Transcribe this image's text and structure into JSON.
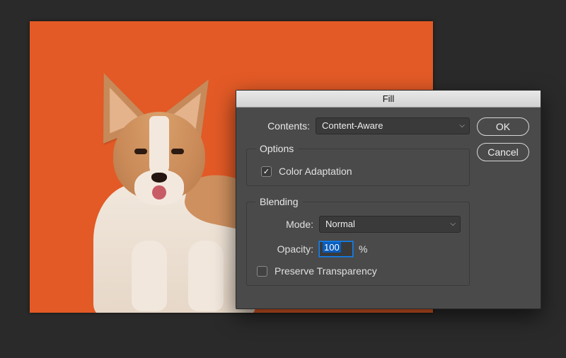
{
  "canvas": {
    "bg_color": "#e35a26",
    "subject": "corgi-puppy"
  },
  "dialog": {
    "title": "Fill",
    "contents_label": "Contents:",
    "contents_value": "Content-Aware",
    "options_legend": "Options",
    "color_adaptation_label": "Color Adaptation",
    "color_adaptation_checked": true,
    "blending_legend": "Blending",
    "mode_label": "Mode:",
    "mode_value": "Normal",
    "opacity_label": "Opacity:",
    "opacity_value": "100",
    "opacity_suffix": "%",
    "preserve_transparency_label": "Preserve Transparency",
    "preserve_transparency_checked": false,
    "ok_label": "OK",
    "cancel_label": "Cancel"
  }
}
